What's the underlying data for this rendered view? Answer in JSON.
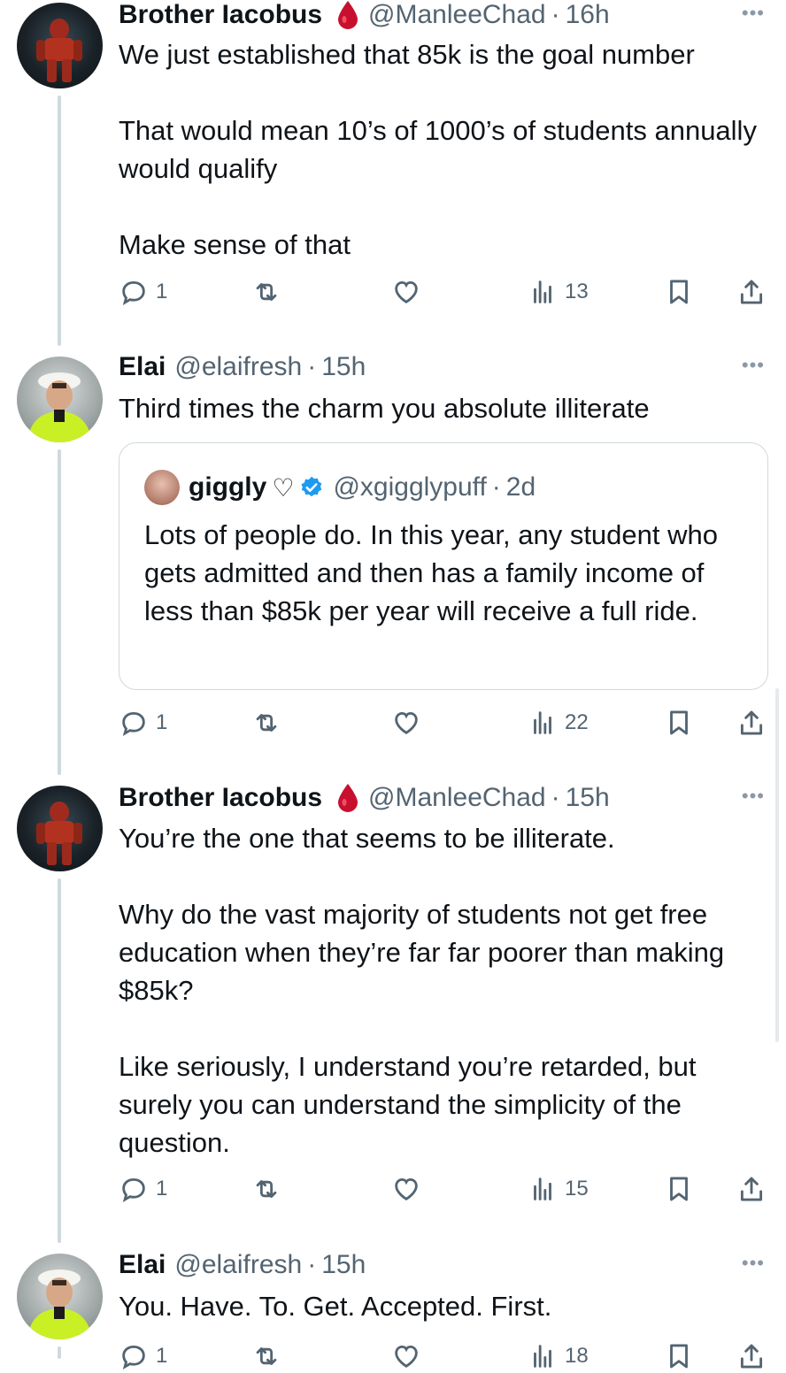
{
  "posts": [
    {
      "name": "Brother Iacobus",
      "handle": "@ManleeChad",
      "time": "16h",
      "text": "We just established that 85k is the goal number\n\nThat would mean 10’s of 1000’s of students annually would qualify\n\nMake sense of that",
      "replies": "1",
      "views": "13"
    },
    {
      "name": "Elai",
      "handle": "@elaifresh",
      "time": "15h",
      "text": "Third times the charm you absolute illiterate",
      "quote": {
        "name": "giggly",
        "heart": "♡",
        "handle": "@xgigglypuff",
        "time": "2d",
        "text": "Lots of people do. In this year, any student who gets admitted and then has a family income of less than $85k per year will receive a full ride."
      },
      "replies": "1",
      "views": "22"
    },
    {
      "name": "Brother Iacobus",
      "handle": "@ManleeChad",
      "time": "15h",
      "text": "You’re the one that seems to be illiterate.\n\nWhy do the vast majority of students not get free education when they’re far far poorer than making $85k?\n\nLike seriously, I understand you’re retarded, but surely you can understand the simplicity of the question.",
      "replies": "1",
      "views": "15"
    },
    {
      "name": "Elai",
      "handle": "@elaifresh",
      "time": "15h",
      "text": "You. Have. To. Get. Accepted. First.",
      "replies": "1",
      "views": "18"
    }
  ],
  "ui": {
    "separator": "·",
    "more": "•••"
  },
  "colors": {
    "accent": "#1d9bf0",
    "secondary_text": "#536471",
    "blood_drop": "#c8102e"
  }
}
